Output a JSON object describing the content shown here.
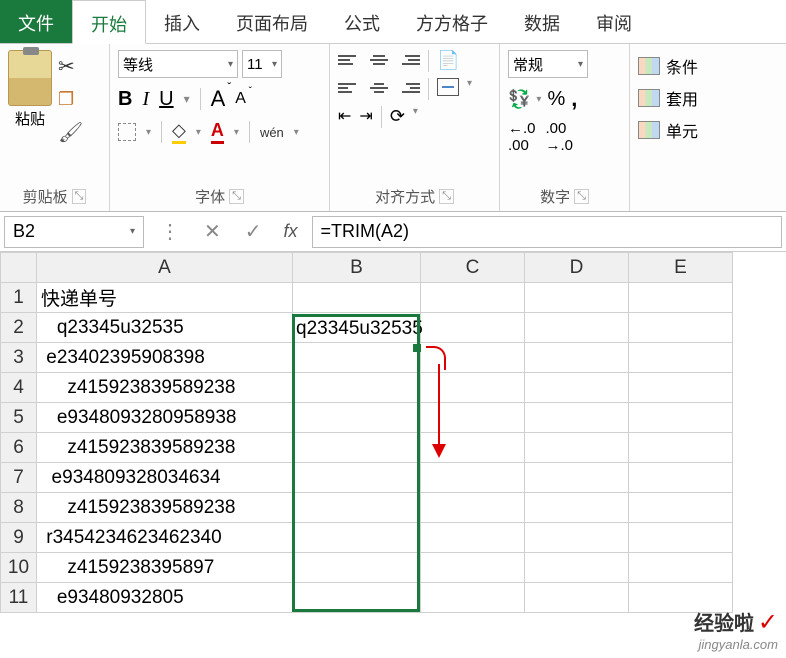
{
  "tabs": {
    "file": "文件",
    "active": "开始",
    "items": [
      "插入",
      "页面布局",
      "公式",
      "方方格子",
      "数据",
      "审阅"
    ]
  },
  "ribbon": {
    "clipboard": {
      "paste": "粘贴",
      "label": "剪贴板"
    },
    "font": {
      "name": "等线",
      "size": "11",
      "label": "字体",
      "wen": "wén"
    },
    "align": {
      "label": "对齐方式"
    },
    "number": {
      "format": "常规",
      "label": "数字",
      "inc": "←.0",
      "dec": ".00",
      "inc2": ".00",
      "dec2": "→.0"
    },
    "styles": {
      "cond": "条件",
      "fmt": "套用",
      "cell": "单元"
    }
  },
  "namebox": "B2",
  "formula": "=TRIM(A2)",
  "headers": {
    "A": "A",
    "B": "B",
    "C": "C",
    "D": "D",
    "E": "E"
  },
  "rows": [
    {
      "n": "1",
      "A": "快递单号",
      "B": ""
    },
    {
      "n": "2",
      "A": "   q23345u32535",
      "B": "q23345u32535"
    },
    {
      "n": "3",
      "A": " e23402395908398",
      "B": ""
    },
    {
      "n": "4",
      "A": "     z415923839589238",
      "B": ""
    },
    {
      "n": "5",
      "A": "   e9348093280958938",
      "B": ""
    },
    {
      "n": "6",
      "A": "     z415923839589238",
      "B": ""
    },
    {
      "n": "7",
      "A": "  e934809328034634",
      "B": ""
    },
    {
      "n": "8",
      "A": "     z415923839589238",
      "B": ""
    },
    {
      "n": "9",
      "A": " r3454234623462340",
      "B": ""
    },
    {
      "n": "10",
      "A": "     z4159238395897",
      "B": ""
    },
    {
      "n": "11",
      "A": "   e93480932805",
      "B": ""
    }
  ],
  "watermark": {
    "name": "经验啦",
    "url": "jingyanla.com"
  }
}
